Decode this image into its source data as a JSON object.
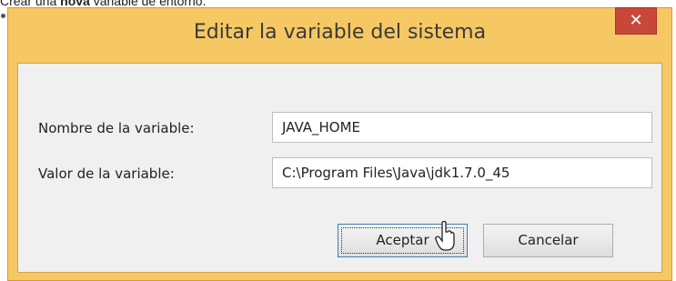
{
  "caption": {
    "prefix": "Crear una ",
    "bold": "nova",
    "suffix": " variable de entorno."
  },
  "dialog": {
    "title": "Editar la variable del sistema",
    "close_label": "✕",
    "fields": {
      "name_label": "Nombre de la variable:",
      "name_value": "JAVA_HOME",
      "value_label": "Valor de la variable:",
      "value_value": "C:\\Program Files\\Java\\jdk1.7.0_45"
    },
    "buttons": {
      "ok": "Aceptar",
      "cancel": "Cancelar"
    }
  },
  "colors": {
    "frame": "#f6c863",
    "close": "#c9473a",
    "client": "#f0f0f0"
  },
  "icons": {
    "close": "close-icon",
    "pointer": "mouse-pointer-icon"
  }
}
